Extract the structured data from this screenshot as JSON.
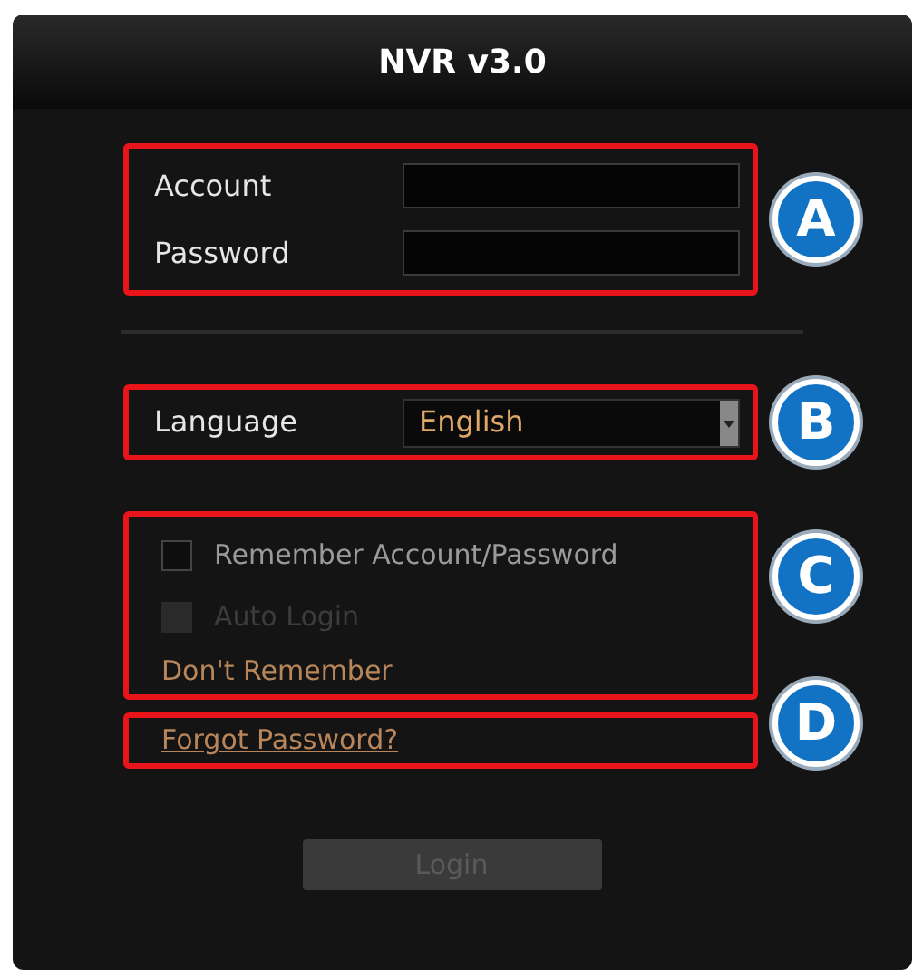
{
  "window": {
    "title": "NVR v3.0"
  },
  "callouts": [
    "A",
    "B",
    "C",
    "D"
  ],
  "fields": [
    {
      "label": "Account"
    },
    {
      "label": "Password"
    }
  ],
  "language": {
    "label": "Language",
    "value": "English"
  },
  "options": [
    {
      "label": "Remember Account/Password",
      "checked": false,
      "disabled": false
    },
    {
      "label": "Auto Login",
      "checked": false,
      "disabled": true
    }
  ],
  "dont_remember": "Don't Remember",
  "forgot_link": "Forgot Password?",
  "login_button": {
    "label": "Login",
    "disabled": true
  }
}
